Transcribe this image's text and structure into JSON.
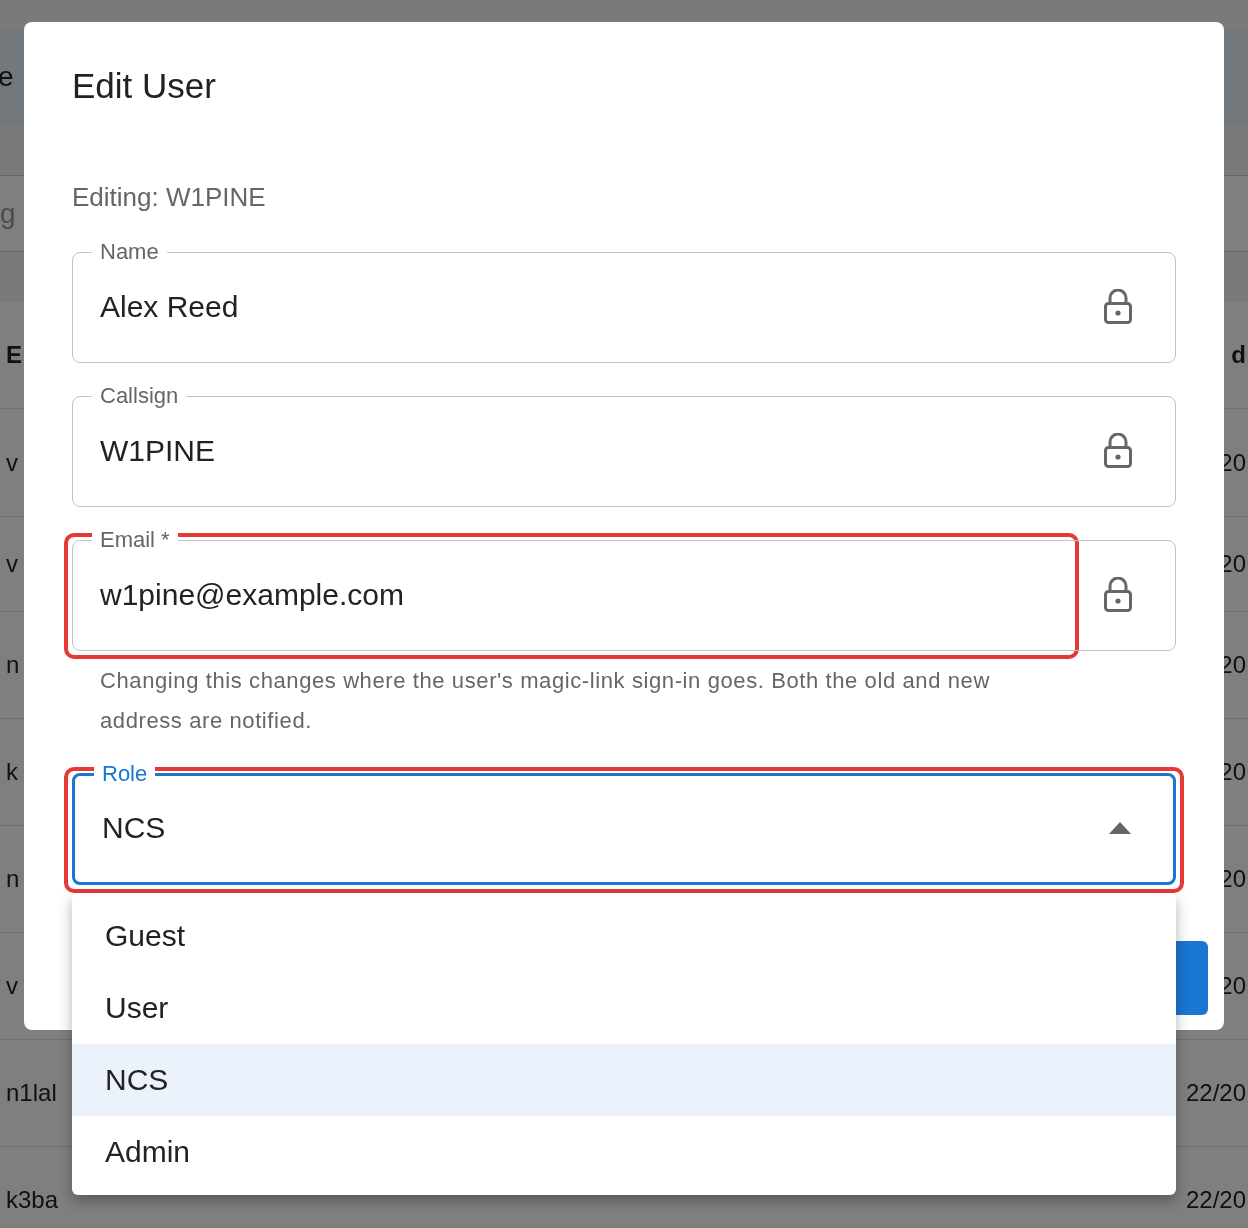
{
  "background": {
    "header_text": "e",
    "search_text": "g",
    "table": {
      "columns": [
        {
          "label": "E"
        },
        {
          "label": "d"
        }
      ],
      "rows": [
        {
          "cells": [
            "v",
            "20"
          ]
        },
        {
          "cells": [
            "v",
            "20"
          ]
        },
        {
          "cells": [
            "n",
            "20"
          ]
        },
        {
          "cells": [
            "k",
            "20"
          ]
        },
        {
          "cells": [
            "n",
            "20"
          ]
        },
        {
          "cells": [
            "v",
            "20"
          ]
        },
        {
          "cells": [
            "n1lal",
            "22/20"
          ]
        },
        {
          "cells": [
            "k3ba",
            "22/20"
          ]
        }
      ]
    }
  },
  "dialog": {
    "title": "Edit User",
    "subtitle": "Editing: W1PINE",
    "fields": [
      {
        "kind": "text",
        "label": "Name",
        "value": "Alex Reed",
        "locked": true,
        "highlighted": false
      },
      {
        "kind": "text",
        "label": "Callsign",
        "value": "W1PINE",
        "locked": true,
        "highlighted": false
      },
      {
        "kind": "text",
        "label": "Email *",
        "value": "w1pine@example.com",
        "locked": true,
        "highlighted": true,
        "helper": "Changing this changes where the user's magic-link sign-in goes. Both the old and new address are notified."
      },
      {
        "kind": "select",
        "label": "Role",
        "value": "NCS",
        "focused": true,
        "expanded": true,
        "highlighted": true
      }
    ],
    "menu": [
      {
        "label": "Guest",
        "selected": false
      },
      {
        "label": "User",
        "selected": false
      },
      {
        "label": "NCS",
        "selected": true
      },
      {
        "label": "Admin",
        "selected": false
      }
    ]
  }
}
